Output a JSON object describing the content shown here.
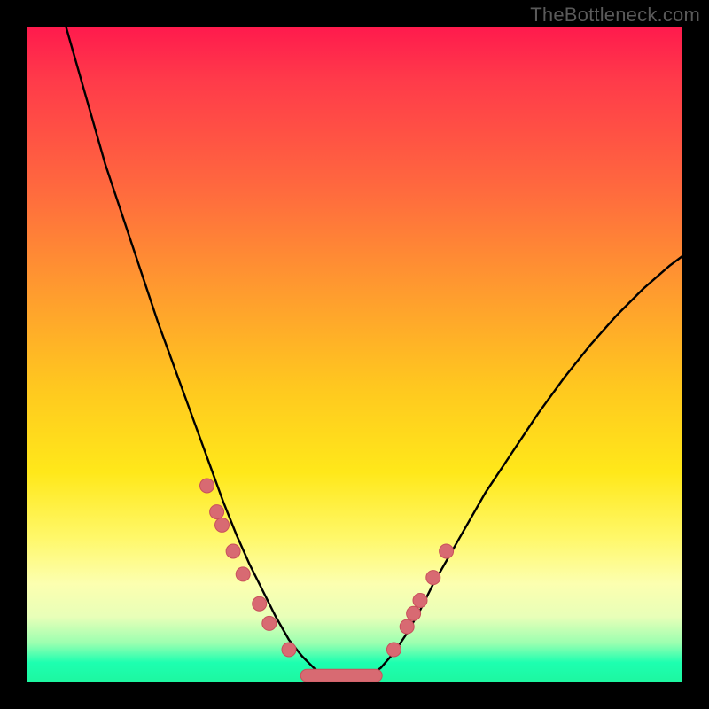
{
  "watermark": "TheBottleneck.com",
  "colors": {
    "curve_stroke": "#000000",
    "marker_fill": "#d86a72",
    "marker_stroke": "#c9505c"
  },
  "chart_data": {
    "type": "line",
    "title": "",
    "xlabel": "",
    "ylabel": "",
    "xlim": [
      0,
      100
    ],
    "ylim": [
      0,
      100
    ],
    "series": [
      {
        "name": "curve",
        "x": [
          6,
          8,
          10,
          12,
          14,
          16,
          18,
          20,
          22,
          24,
          26,
          28,
          30,
          32,
          34,
          36,
          38,
          40,
          42,
          44,
          46,
          48,
          50,
          52,
          54,
          56,
          58,
          60,
          62,
          66,
          70,
          74,
          78,
          82,
          86,
          90,
          94,
          98,
          100
        ],
        "y": [
          100,
          93,
          86,
          79,
          73,
          67,
          61,
          55,
          49.5,
          44,
          38.5,
          33,
          27.5,
          22.5,
          18,
          14,
          10,
          6.5,
          4,
          2,
          0.8,
          0.3,
          0.3,
          0.9,
          2.2,
          4.5,
          7.5,
          11,
          15,
          22,
          29,
          35,
          41,
          46.5,
          51.5,
          56,
          60,
          63.5,
          65
        ]
      }
    ],
    "markers": {
      "left_cluster": [
        {
          "x": 27.5,
          "y": 30
        },
        {
          "x": 29,
          "y": 26
        },
        {
          "x": 29.8,
          "y": 24
        },
        {
          "x": 31.5,
          "y": 20
        },
        {
          "x": 33,
          "y": 16.5
        },
        {
          "x": 35.5,
          "y": 12
        },
        {
          "x": 37,
          "y": 9
        },
        {
          "x": 40,
          "y": 5
        }
      ],
      "right_cluster": [
        {
          "x": 56,
          "y": 5
        },
        {
          "x": 58,
          "y": 8.5
        },
        {
          "x": 59,
          "y": 10.5
        },
        {
          "x": 60,
          "y": 12.5
        },
        {
          "x": 62,
          "y": 16
        },
        {
          "x": 64,
          "y": 20
        }
      ],
      "bottom_band": [
        {
          "x": 43,
          "y": 1.2
        },
        {
          "x": 45,
          "y": 0.8
        },
        {
          "x": 47,
          "y": 0.5
        },
        {
          "x": 49,
          "y": 0.4
        },
        {
          "x": 51,
          "y": 0.5
        },
        {
          "x": 53,
          "y": 0.9
        }
      ]
    }
  }
}
